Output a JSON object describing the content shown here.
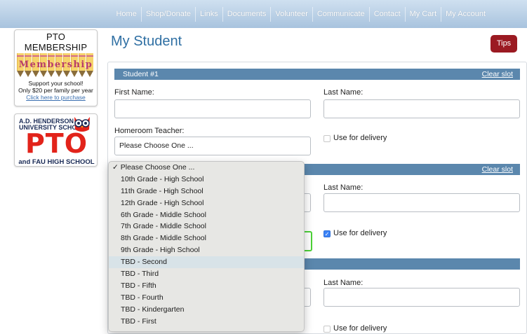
{
  "nav": {
    "items": [
      "Home",
      "Shop/Donate",
      "Links",
      "Documents",
      "Volunteer",
      "Communicate",
      "Contact",
      "My Cart",
      "My Account"
    ]
  },
  "sidebar": {
    "membership": {
      "title": "PTO MEMBERSHIP",
      "pencil_word": "Membership",
      "line1": "Support your school!",
      "line2": "Only $20 per family per year",
      "link": "Click here to purchase"
    },
    "pto": {
      "school": "A.D. HENDERSON UNIVERSITY SCHOOL",
      "school_line1": "A.D. HENDERSON",
      "school_line2": "UNIVERSITY SCHOOL",
      "big": "PTO",
      "sub": "and FAU HIGH SCHOOL"
    }
  },
  "page": {
    "title": "My Student",
    "tips_label": "Tips"
  },
  "slots": [
    {
      "header": "Student #1",
      "clear_label": "Clear slot",
      "first_name_label": "First Name:",
      "last_name_label": "Last Name:",
      "first_name_value": "",
      "last_name_value": "",
      "homeroom_label": "Homeroom Teacher:",
      "homeroom_value": "Please Choose One ...",
      "delivery_label": "Use for delivery",
      "delivery_checked": false
    },
    {
      "header": "",
      "clear_label": "Clear slot",
      "last_name_label": "Last Name:",
      "delivery_label": "Use for delivery",
      "delivery_checked": true
    },
    {
      "header": "",
      "last_name_label": "Last Name:",
      "delivery_label": "Use for delivery",
      "delivery_checked": false
    }
  ],
  "dropdown": {
    "options": [
      "Please Choose One ...",
      "10th Grade - High School",
      "11th Grade - High School",
      "12th Grade - High School",
      "6th Grade - Middle School",
      "7th Grade - Middle School",
      "8th Grade - Middle School",
      "9th Grade - High School",
      "TBD - Second",
      "TBD - Third",
      "TBD - Fifth",
      "TBD - Fourth",
      "TBD - Kindergarten",
      "TBD - First"
    ],
    "selected_index": 0,
    "highlighted_index": 8,
    "checkmark": "✓"
  },
  "colors": {
    "accent": "#2f6fa3",
    "slot_bar": "#5b87ad",
    "tips": "#9b1a22",
    "pto_red": "#e2231a",
    "focus_green": "#4cd137"
  }
}
